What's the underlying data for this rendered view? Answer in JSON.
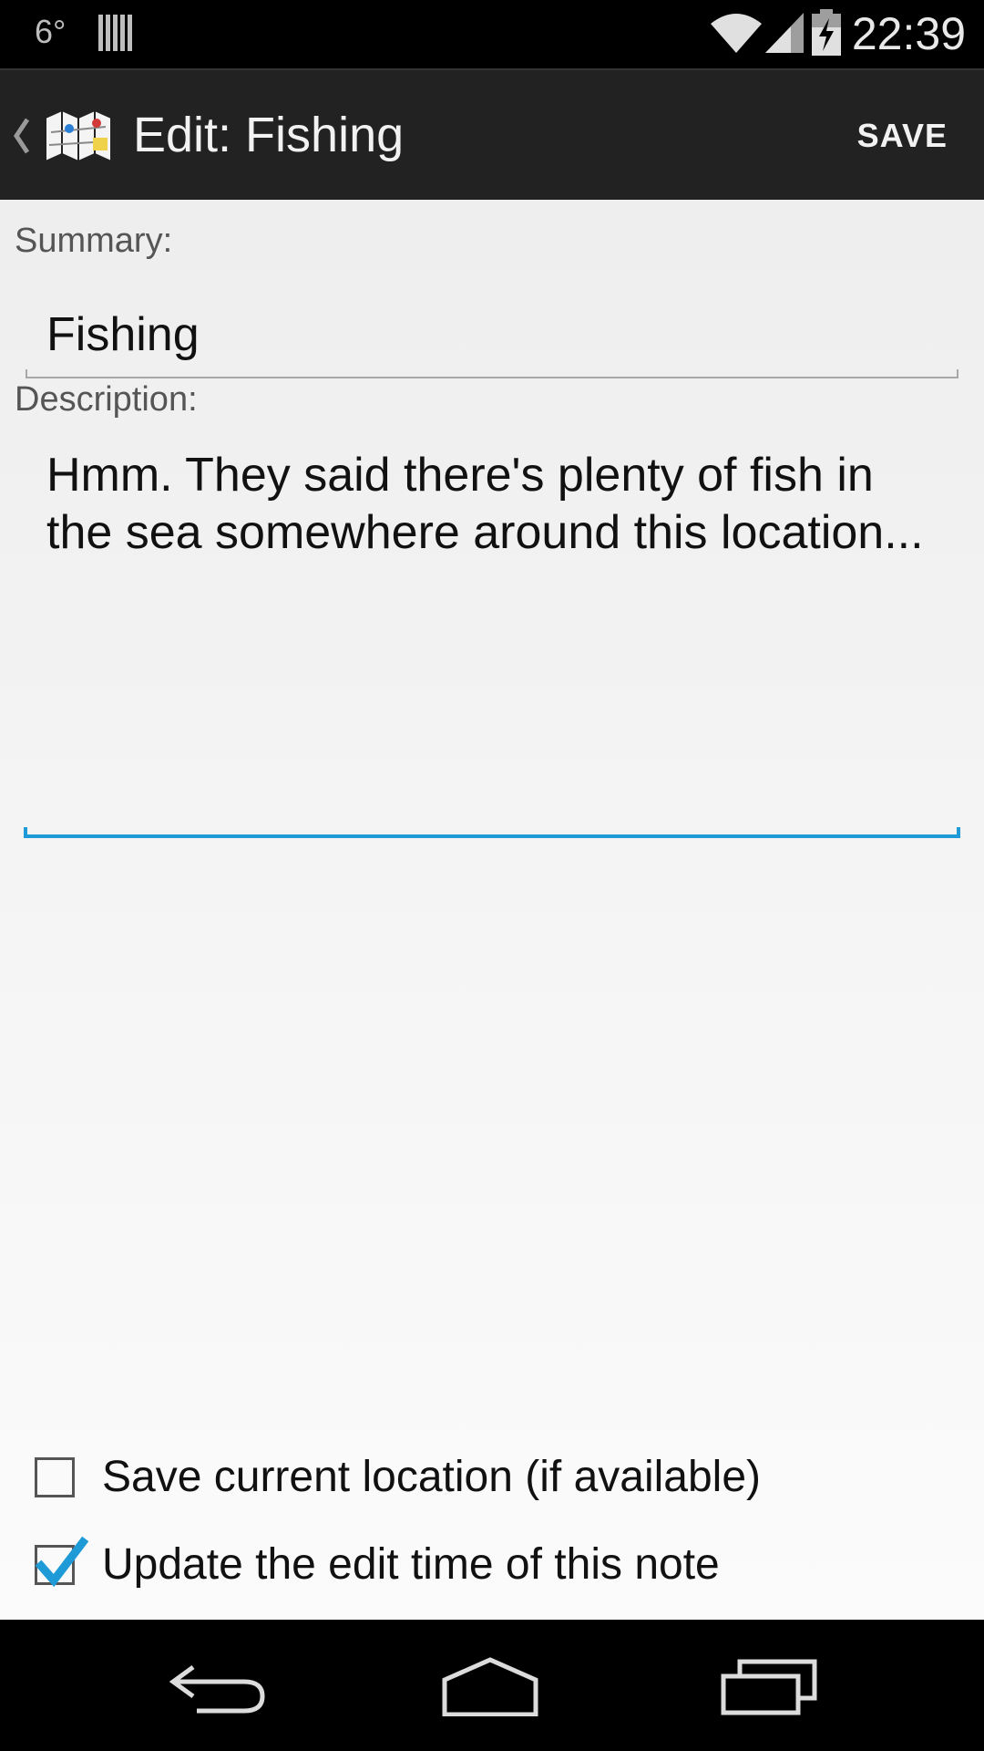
{
  "status_bar": {
    "temperature": "6°",
    "time": "22:39",
    "icons": [
      "notification-icon",
      "wifi-icon",
      "signal-icon",
      "battery-charging-icon"
    ]
  },
  "action_bar": {
    "title": "Edit: Fishing",
    "save_label": "SAVE",
    "icons": [
      "up-caret-icon",
      "map-app-icon"
    ]
  },
  "form": {
    "summary_label": "Summary:",
    "summary_value": "Fishing",
    "description_label": "Description:",
    "description_value": "Hmm. They said there's plenty of fish in the sea somewhere around this location..."
  },
  "options": {
    "save_location_label": "Save current location (if available)",
    "save_location_checked": false,
    "update_time_label": "Update the edit time of this note",
    "update_time_checked": true
  },
  "colors": {
    "accent": "#1e9ad6",
    "action_bar": "#222222",
    "content_bg": "#eeeeee"
  },
  "nav_bar": {
    "icons": [
      "back-icon",
      "home-icon",
      "recents-icon"
    ]
  }
}
